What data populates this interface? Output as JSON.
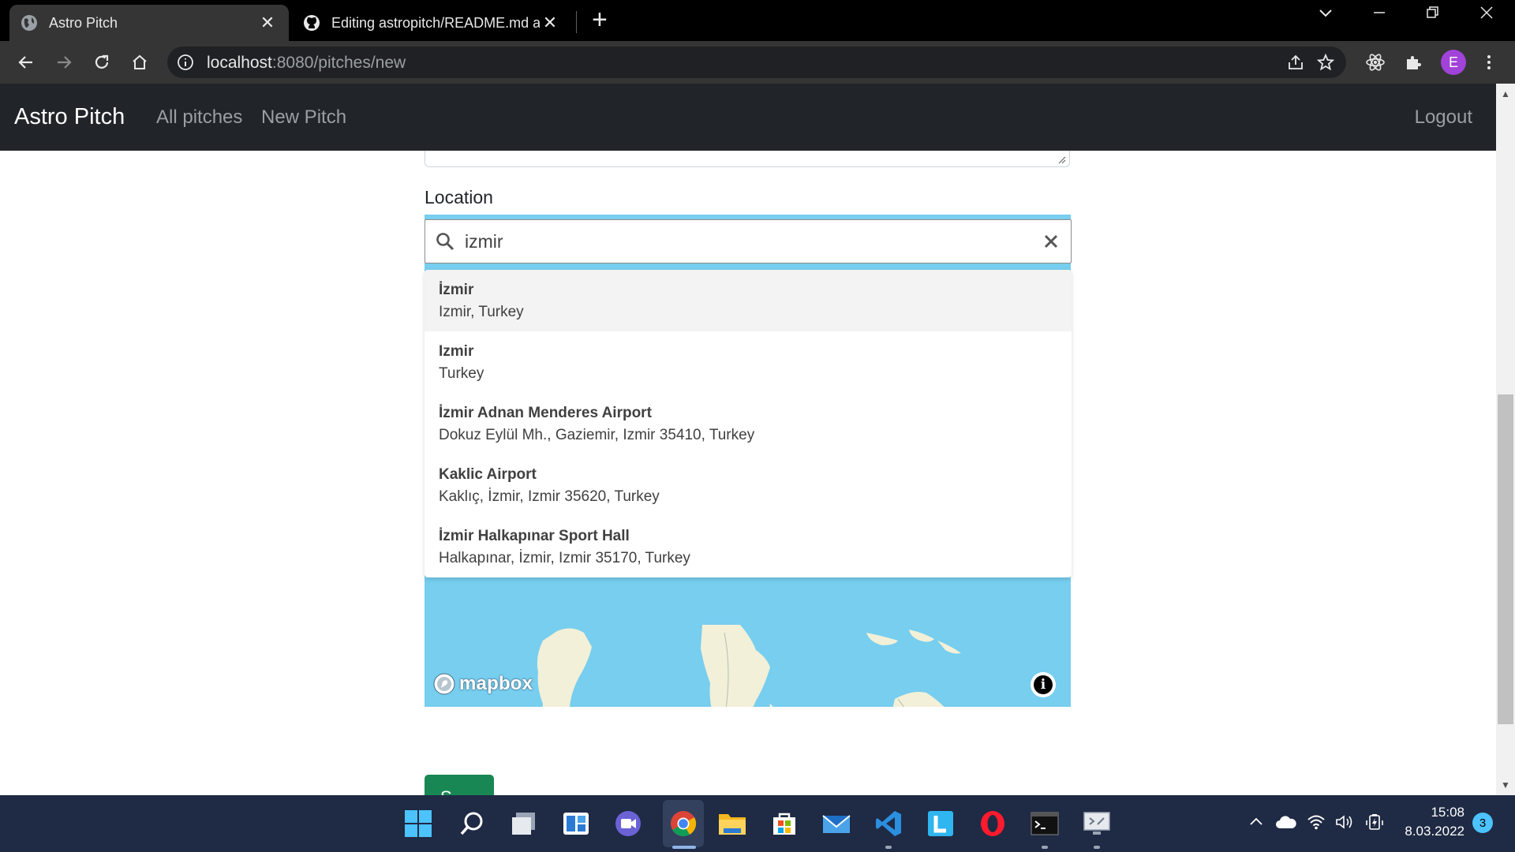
{
  "browser": {
    "tabs": [
      {
        "title": "Astro Pitch",
        "active": true
      },
      {
        "title": "Editing astropitch/README.md a",
        "active": false
      }
    ],
    "address": {
      "host": "localhost",
      "rest": ":8080/pitches/new"
    },
    "profile_initial": "E"
  },
  "navbar": {
    "brand": "Astro Pitch",
    "links": [
      "All pitches",
      "New Pitch"
    ],
    "logout": "Logout"
  },
  "form": {
    "location_label": "Location",
    "search_value": "izmir",
    "save_label": "S"
  },
  "suggestions": [
    {
      "title": "İzmir",
      "address": "Izmir, Turkey"
    },
    {
      "title": "Izmir",
      "address": "Turkey"
    },
    {
      "title": "İzmir Adnan Menderes Airport",
      "address": "Dokuz Eylül Mh., Gaziemir, Izmir 35410, Turkey"
    },
    {
      "title": "Kaklic Airport",
      "address": "Kaklıç, İzmir, Izmir 35620, Turkey"
    },
    {
      "title": "İzmir Halkapınar Sport Hall",
      "address": "Halkapınar, İzmir, Izmir 35170, Turkey"
    }
  ],
  "map": {
    "logo_text": "mapbox",
    "info_glyph": "i"
  },
  "taskbar": {
    "time": "15:08",
    "date": "8.03.2022",
    "notification_count": "3"
  },
  "colors": {
    "navbar_bg": "#212529",
    "map_water": "#77ceef",
    "map_land": "#f2f0d8",
    "save_button": "#198754",
    "avatar": "#a142d8"
  }
}
